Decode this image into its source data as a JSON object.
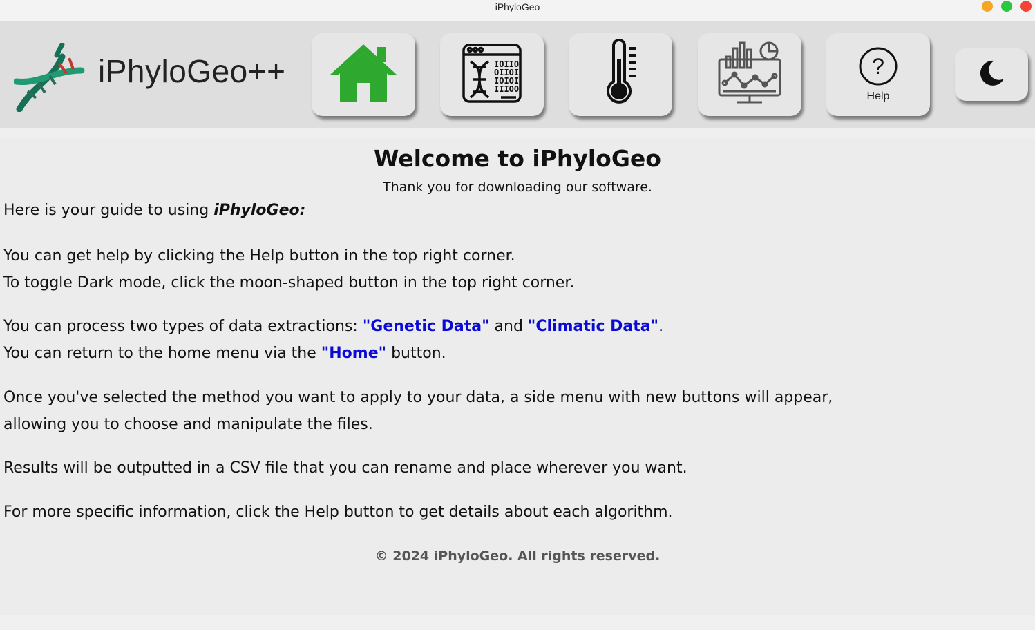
{
  "window": {
    "title": "iPhyloGeo"
  },
  "toolbar": {
    "brand": "iPhyloGeo++",
    "help_label": "Help",
    "icons": [
      "dna-logo-icon",
      "home-icon",
      "genetic-data-icon",
      "thermometer-icon",
      "analytics-dashboard-icon",
      "question-mark-icon",
      "moon-icon"
    ]
  },
  "main": {
    "title": "Welcome to iPhyloGeo",
    "subtitle": "Thank you for downloading our software.",
    "guide_prefix": "Here is your guide to using ",
    "guide_app": "iPhyloGeo:",
    "help_line": "You can get help by clicking the Help button in the top right corner.",
    "dark_line": "To toggle Dark mode, click the moon-shaped button in the top right corner.",
    "process_prefix": "You can process two types of data extractions: ",
    "genetic": "\"Genetic Data\"",
    "and": " and ",
    "climatic": "\"Climatic Data\"",
    "period": ".",
    "home_prefix": "You can return to the home menu via the ",
    "home": "\"Home\"",
    "home_suffix": " button.",
    "method_line1": "Once you've selected the method you want to apply to your data, a side menu with new buttons will appear,",
    "method_line2": "allowing you to choose and manipulate the files.",
    "results_line": "Results will be outputted in a CSV file that you can rename and place wherever you want.",
    "info_line": "For more specific information, click the Help button to get details about each algorithm.",
    "copyright": "© 2024 iPhyloGeo. All rights reserved."
  },
  "colors": {
    "accent_link": "#0a0ad6",
    "home_icon": "#2ea82e",
    "logo_teal": "#1a8a6a"
  }
}
